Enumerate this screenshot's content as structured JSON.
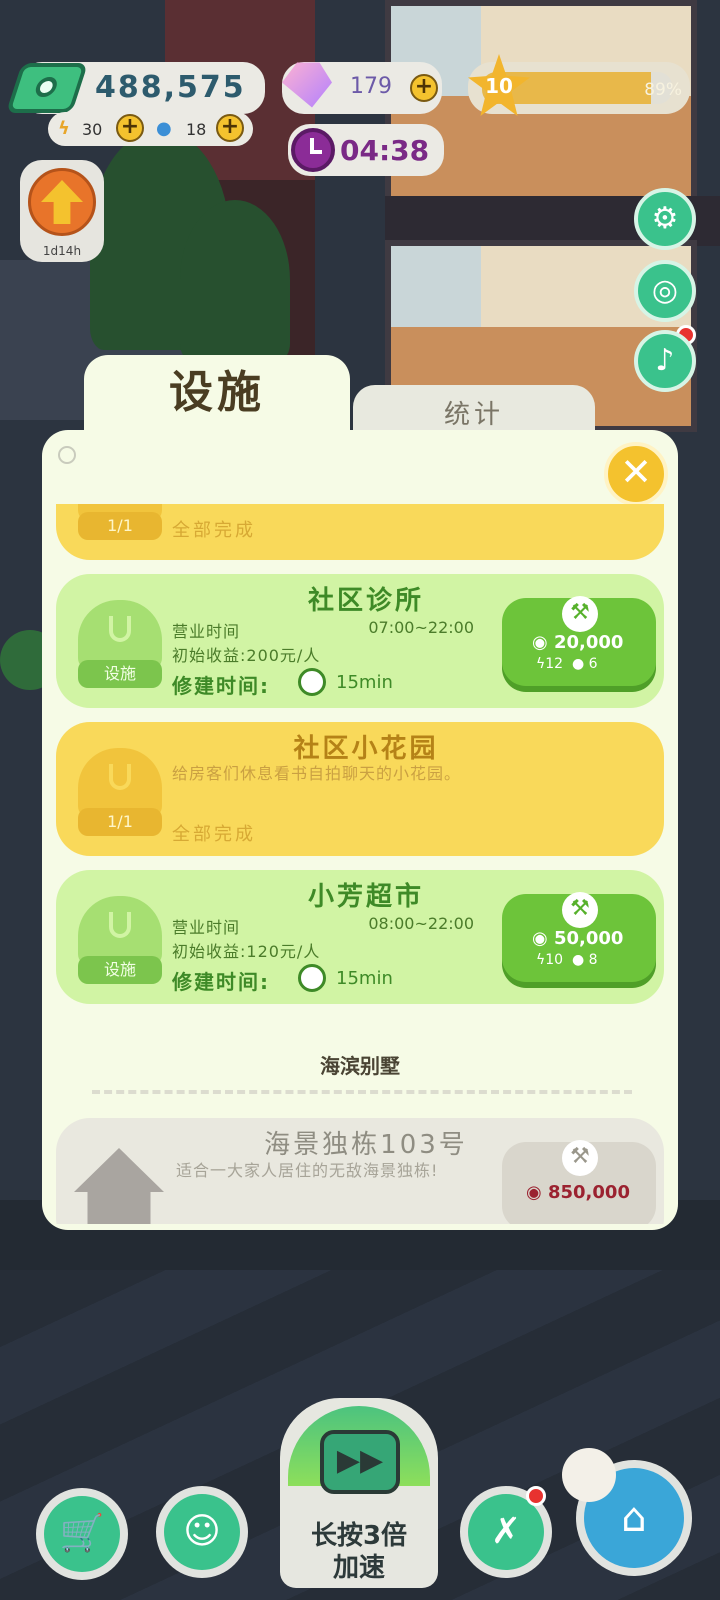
{
  "hud": {
    "money": "488,575",
    "energy": "30",
    "water": "18",
    "gems": "179",
    "level": "10",
    "level_percent": "89%",
    "level_progress": 0.89,
    "timer": "04:38",
    "upgrade_timer": "1d14h"
  },
  "tabs": {
    "active": "设施",
    "inactive": "统计"
  },
  "cards": [
    {
      "type": "done",
      "badge": "1/1",
      "status": "全部完成"
    },
    {
      "type": "build",
      "title": "社区诊所",
      "badge": "设施",
      "hours_label": "营业时间",
      "hours": "07:00~22:00",
      "income": "初始收益:200元/人",
      "build_label": "修建时间:",
      "build_time": "15min",
      "cost": "20,000",
      "energy_cost": "12",
      "water_cost": "6"
    },
    {
      "type": "done",
      "title": "社区小花园",
      "badge": "1/1",
      "desc": "给房客们休息看书自拍聊天的小花园。",
      "status": "全部完成"
    },
    {
      "type": "build",
      "title": "小芳超市",
      "badge": "设施",
      "hours_label": "营业时间",
      "hours": "08:00~22:00",
      "income": "初始收益:120元/人",
      "build_label": "修建时间:",
      "build_time": "15min",
      "cost": "50,000",
      "energy_cost": "10",
      "water_cost": "8"
    }
  ],
  "section": {
    "title": "海滨别墅"
  },
  "locked_card": {
    "title": "海景独栋103号",
    "desc": "适合一大家人居住的无敌海景独栋!",
    "cost": "850,000"
  },
  "bottom": {
    "speed_label_line1": "长按3倍",
    "speed_label_line2": "加速"
  },
  "colors": {
    "green_card": "#d1f4a4",
    "yellow_card": "#f9d95a",
    "accent_green": "#3ac28c",
    "button_green": "#6dc43a"
  }
}
